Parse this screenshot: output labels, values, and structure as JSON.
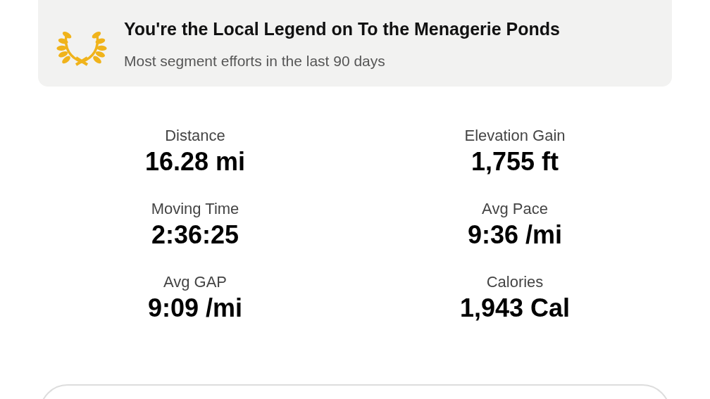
{
  "banner": {
    "title": "You're the Local Legend on To the Menagerie Ponds",
    "subtitle": "Most segment efforts in the last 90 days"
  },
  "stats": [
    {
      "label": "Distance",
      "value": "16.28 mi"
    },
    {
      "label": "Elevation Gain",
      "value": "1,755 ft"
    },
    {
      "label": "Moving Time",
      "value": "2:36:25"
    },
    {
      "label": "Avg Pace",
      "value": "9:36 /mi"
    },
    {
      "label": "Avg GAP",
      "value": "9:09 /mi"
    },
    {
      "label": "Calories",
      "value": "1,943 Cal"
    }
  ]
}
